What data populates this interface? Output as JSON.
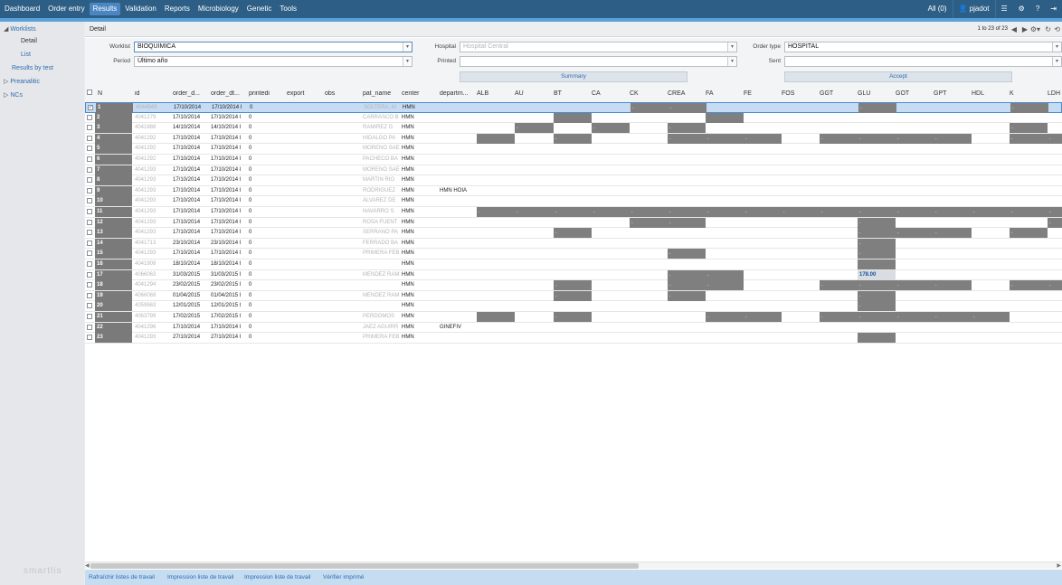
{
  "nav": {
    "items": [
      "Dashboard",
      "Order entry",
      "Results",
      "Validation",
      "Reports",
      "Microbiology",
      "Genetic",
      "Tools"
    ],
    "active": "Results",
    "all_label": "All (0)",
    "user": "pjadot"
  },
  "sidebar": {
    "worklists": "Worklists",
    "detail": "Detail",
    "list": "List",
    "results_by_test": "Results by test",
    "preanalitic": "Preanalitic",
    "ncs": "NCs",
    "brand": "smartlis"
  },
  "header": {
    "title": "Detail",
    "pager": "1 to 23 of 23"
  },
  "form": {
    "worklist_label": "Worklist",
    "worklist_value": "BIOQUIMICA",
    "period_label": "Period",
    "period_value": "Último año",
    "hospital_label": "Hospital",
    "hospital_value": "Hospital Central",
    "printed_label": "Printed",
    "printed_value": "",
    "order_type_label": "Order type",
    "order_type_value": "HOSPITAL",
    "sent_label": "Sent",
    "sent_value": "",
    "summary_button": "Summary",
    "accept_button": "Accept"
  },
  "table": {
    "columns": [
      "N",
      "id",
      "order_d...",
      "order_dt...",
      "printedi",
      "export",
      "obs",
      "pat_name",
      "center",
      "departm...",
      "ALB",
      "AU",
      "BT",
      "CA",
      "CK",
      "CREA",
      "FA",
      "FE",
      "FOS",
      "GGT",
      "GLU",
      "GOT",
      "GPT",
      "HDL",
      "K",
      "LDH"
    ],
    "rows": [
      {
        "n": "1",
        "id": "4044949",
        "d1": "17/10/2014",
        "d2": "17/10/2014 I",
        "pr": "0",
        "pat": "SOLTERA, M",
        "center": "HMN",
        "dept": "",
        "selected": true
      },
      {
        "n": "2",
        "id": "4041279",
        "d1": "17/10/2014",
        "d2": "17/10/2014 I",
        "pr": "0",
        "pat": "CARRASCO B",
        "center": "HMN",
        "dept": ""
      },
      {
        "n": "3",
        "id": "4041888",
        "d1": "14/10/2014",
        "d2": "14/10/2014 I",
        "pr": "0",
        "pat": "RAMIREZ G",
        "center": "HMN",
        "dept": ""
      },
      {
        "n": "4",
        "id": "4041292",
        "d1": "17/10/2014",
        "d2": "17/10/2014 I",
        "pr": "0",
        "pat": "HIDALGO PA",
        "center": "HMN",
        "dept": ""
      },
      {
        "n": "5",
        "id": "4041292",
        "d1": "17/10/2014",
        "d2": "17/10/2014 I",
        "pr": "0",
        "pat": "MORENO SAE",
        "center": "HMN",
        "dept": ""
      },
      {
        "n": "6",
        "id": "4041292",
        "d1": "17/10/2014",
        "d2": "17/10/2014 I",
        "pr": "0",
        "pat": "PACHECO BA",
        "center": "HMN",
        "dept": ""
      },
      {
        "n": "7",
        "id": "4041293",
        "d1": "17/10/2014",
        "d2": "17/10/2014 I",
        "pr": "0",
        "pat": "MORENO SAE",
        "center": "HMN",
        "dept": ""
      },
      {
        "n": "8",
        "id": "4041293",
        "d1": "17/10/2014",
        "d2": "17/10/2014 I",
        "pr": "0",
        "pat": "MARTIN RIO",
        "center": "HMN",
        "dept": ""
      },
      {
        "n": "9",
        "id": "4041293",
        "d1": "17/10/2014",
        "d2": "17/10/2014 I",
        "pr": "0",
        "pat": "RODRIGUEZ",
        "center": "HMN",
        "dept": "HMN HOIA"
      },
      {
        "n": "10",
        "id": "4041293",
        "d1": "17/10/2014",
        "d2": "17/10/2014 I",
        "pr": "0",
        "pat": "ALVAREZ DE",
        "center": "HMN",
        "dept": ""
      },
      {
        "n": "11",
        "id": "4041293",
        "d1": "17/10/2014",
        "d2": "17/10/2014 I",
        "pr": "0",
        "pat": "NAVARRO S",
        "center": "HMN",
        "dept": ""
      },
      {
        "n": "12",
        "id": "4041293",
        "d1": "17/10/2014",
        "d2": "17/10/2014 I",
        "pr": "0",
        "pat": "ROSA FUENT",
        "center": "HMN",
        "dept": ""
      },
      {
        "n": "13",
        "id": "4041293",
        "d1": "17/10/2014",
        "d2": "17/10/2014 I",
        "pr": "0",
        "pat": "SERRANO PA",
        "center": "HMN",
        "dept": ""
      },
      {
        "n": "14",
        "id": "4041713",
        "d1": "23/10/2014",
        "d2": "23/10/2014 I",
        "pr": "0",
        "pat": "FERRADO BA",
        "center": "HMN",
        "dept": ""
      },
      {
        "n": "15",
        "id": "4041293",
        "d1": "17/10/2014",
        "d2": "17/10/2014 I",
        "pr": "0",
        "pat": "PRIMERA FEB",
        "center": "HMN",
        "dept": ""
      },
      {
        "n": "16",
        "id": "4041909",
        "d1": "18/10/2014",
        "d2": "18/10/2014 I",
        "pr": "0",
        "pat": "",
        "center": "HMN",
        "dept": ""
      },
      {
        "n": "17",
        "id": "4066063",
        "d1": "31/03/2015",
        "d2": "31/03/2015 I",
        "pr": "0",
        "pat": "MENDEZ RAMI",
        "center": "HMN",
        "dept": ""
      },
      {
        "n": "18",
        "id": "4041294",
        "d1": "23/02/2015",
        "d2": "23/02/2015 I",
        "pr": "0",
        "pat": "",
        "center": "HMN",
        "dept": ""
      },
      {
        "n": "19",
        "id": "4066069",
        "d1": "01/04/2015",
        "d2": "01/04/2015 I",
        "pr": "0",
        "pat": "MENDEZ RAMI",
        "center": "HMN",
        "dept": ""
      },
      {
        "n": "20",
        "id": "4059663",
        "d1": "12/01/2015",
        "d2": "12/01/2015 I",
        "pr": "0",
        "pat": "",
        "center": "HMN",
        "dept": ""
      },
      {
        "n": "21",
        "id": "4063799",
        "d1": "17/02/2015",
        "d2": "17/02/2015 I",
        "pr": "0",
        "pat": "PERDOMOS",
        "center": "HMN",
        "dept": ""
      },
      {
        "n": "22",
        "id": "4041296",
        "d1": "17/10/2014",
        "d2": "17/10/2014 I",
        "pr": "0",
        "pat": "JAEZ AGUIRR",
        "center": "HMN",
        "dept": "GINEFIV"
      },
      {
        "n": "23",
        "id": "4041293",
        "d1": "27/10/2014",
        "d2": "27/10/2014 I",
        "pr": "0",
        "pat": "PRIMERA FEB",
        "center": "HMN",
        "dept": ""
      }
    ],
    "results": [
      [
        0,
        "CK",
        "."
      ],
      [
        0,
        "CREA",
        "."
      ],
      [
        0,
        "GLU",
        "."
      ],
      [
        0,
        "K",
        "."
      ],
      [
        1,
        "BT",
        ""
      ],
      [
        1,
        "FA",
        ""
      ],
      [
        2,
        "AU",
        "."
      ],
      [
        2,
        "CA",
        "."
      ],
      [
        2,
        "CREA",
        "."
      ],
      [
        2,
        "K",
        "."
      ],
      [
        3,
        "ALB",
        ""
      ],
      [
        3,
        "BT",
        "."
      ],
      [
        3,
        "CREA",
        "."
      ],
      [
        3,
        "FA",
        "."
      ],
      [
        3,
        "FE",
        "."
      ],
      [
        3,
        "GGT",
        "."
      ],
      [
        3,
        "GLU",
        "."
      ],
      [
        3,
        "GOT",
        "."
      ],
      [
        3,
        "GPT",
        "."
      ],
      [
        3,
        "K",
        "."
      ],
      [
        3,
        "LDH",
        "."
      ],
      [
        10,
        "ALB",
        "."
      ],
      [
        10,
        "AU",
        "."
      ],
      [
        10,
        "BT",
        "."
      ],
      [
        10,
        "CA",
        "."
      ],
      [
        10,
        "CK",
        "."
      ],
      [
        10,
        "CREA",
        "."
      ],
      [
        10,
        "FA",
        "."
      ],
      [
        10,
        "FE",
        "."
      ],
      [
        10,
        "FOS",
        "."
      ],
      [
        10,
        "GGT",
        "."
      ],
      [
        10,
        "GLU",
        "."
      ],
      [
        10,
        "GOT",
        "."
      ],
      [
        10,
        "GPT",
        "."
      ],
      [
        10,
        "HDL",
        "."
      ],
      [
        10,
        "K",
        "."
      ],
      [
        10,
        "LDH",
        "."
      ],
      [
        11,
        "CK",
        "."
      ],
      [
        11,
        "CREA",
        "."
      ],
      [
        11,
        "GLU",
        "."
      ],
      [
        11,
        "LDH",
        "."
      ],
      [
        12,
        "BT",
        "."
      ],
      [
        12,
        "GLU",
        "."
      ],
      [
        12,
        "GOT",
        "."
      ],
      [
        12,
        "GPT",
        "."
      ],
      [
        12,
        "K",
        "."
      ],
      [
        13,
        "GLU",
        "."
      ],
      [
        14,
        "CREA",
        "."
      ],
      [
        14,
        "GLU",
        "."
      ],
      [
        15,
        "GLU",
        ""
      ],
      [
        16,
        "CREA",
        "."
      ],
      [
        16,
        "FA",
        "."
      ],
      [
        16,
        "GLU",
        "178.00"
      ],
      [
        17,
        "BT",
        "."
      ],
      [
        17,
        "CREA",
        "."
      ],
      [
        17,
        "FA",
        "."
      ],
      [
        17,
        "GGT",
        "."
      ],
      [
        17,
        "GLU",
        "."
      ],
      [
        17,
        "GOT",
        "."
      ],
      [
        17,
        "GPT",
        "."
      ],
      [
        17,
        "K",
        "."
      ],
      [
        17,
        "LDH",
        "."
      ],
      [
        18,
        "BT",
        "."
      ],
      [
        18,
        "CREA",
        "."
      ],
      [
        18,
        "GLU",
        "."
      ],
      [
        19,
        "GLU",
        "."
      ],
      [
        20,
        "ALB",
        ""
      ],
      [
        20,
        "BT",
        "."
      ],
      [
        20,
        "FA",
        "."
      ],
      [
        20,
        "FE",
        "."
      ],
      [
        20,
        "GGT",
        "."
      ],
      [
        20,
        "GLU",
        "."
      ],
      [
        20,
        "GOT",
        "."
      ],
      [
        20,
        "GPT",
        "."
      ],
      [
        20,
        "HDL",
        "."
      ],
      [
        22,
        "GLU",
        ""
      ]
    ]
  },
  "footer": {
    "links": [
      "Rafraîchir listes de travail",
      "Impression liste de travail",
      "Impression liste de travail",
      "Vérifier imprimé"
    ]
  },
  "colors": {
    "topbar": "#2d5f86",
    "active_tab": "#4b86c2",
    "result_cell": "#7f7f7f",
    "selected_row": "#c5dcf4",
    "footer": "#c6dcf1"
  }
}
